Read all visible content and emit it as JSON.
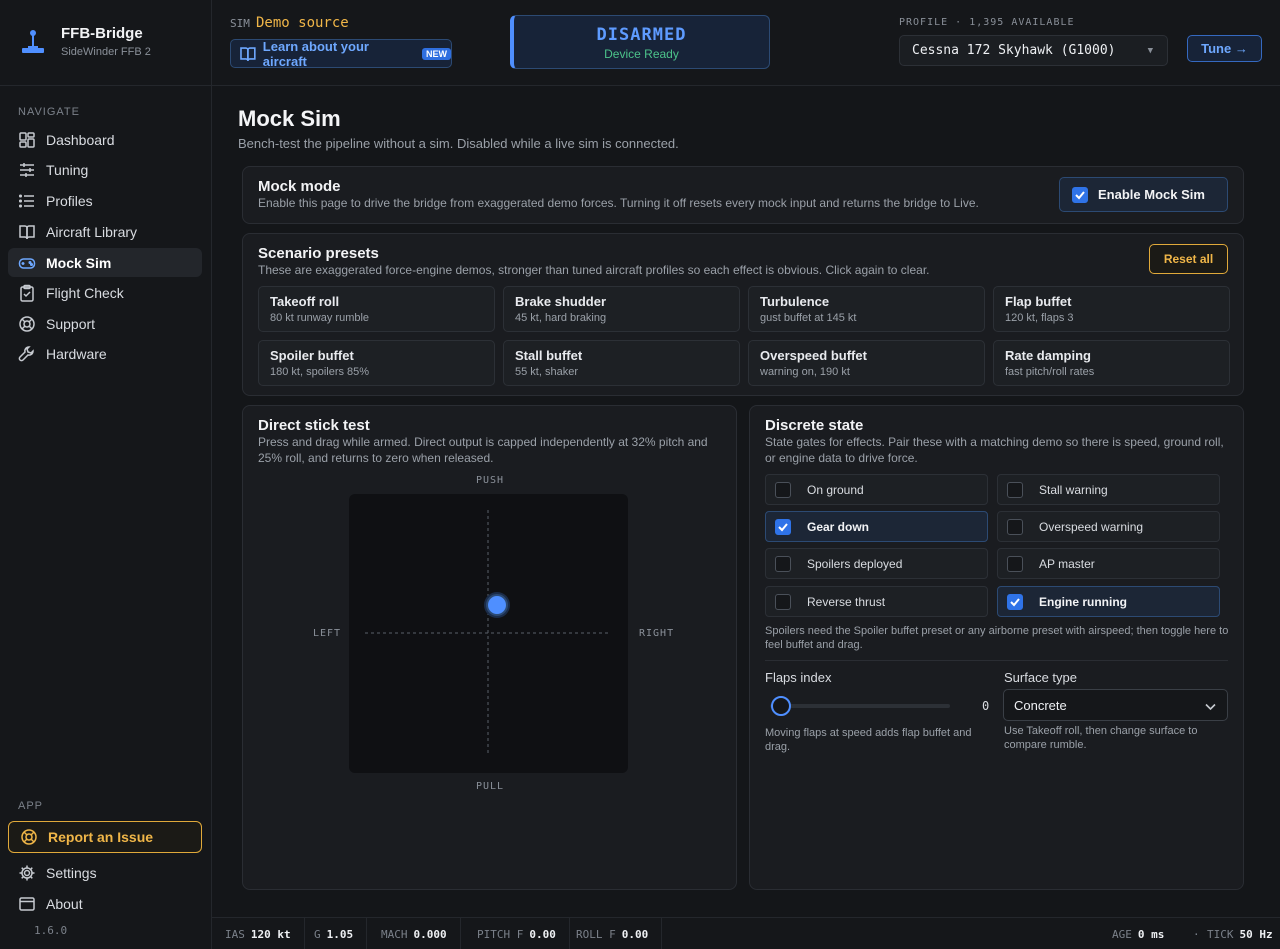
{
  "brand": {
    "title": "FFB-Bridge",
    "subtitle": "SideWinder FFB 2"
  },
  "sidebar": {
    "navigate_heading": "NAVIGATE",
    "items": [
      {
        "label": "Dashboard",
        "icon": "dashboard-icon"
      },
      {
        "label": "Tuning",
        "icon": "sliders-icon"
      },
      {
        "label": "Profiles",
        "icon": "list-icon"
      },
      {
        "label": "Aircraft Library",
        "icon": "book-icon"
      },
      {
        "label": "Mock Sim",
        "icon": "gamepad-icon",
        "active": true
      },
      {
        "label": "Flight Check",
        "icon": "clipboard-check-icon"
      },
      {
        "label": "Support",
        "icon": "lifebuoy-icon"
      },
      {
        "label": "Hardware",
        "icon": "wrench-icon"
      }
    ],
    "app_heading": "APP",
    "report_label": "Report an Issue",
    "settings_label": "Settings",
    "about_label": "About",
    "version": "1.6.0"
  },
  "topbar": {
    "sim_label": "SIM",
    "sim_value": "Demo source",
    "learn_label": "Learn about your aircraft",
    "new_badge": "NEW",
    "arm_status": "DISARMED",
    "arm_sub": "Device Ready",
    "profile_label": "PROFILE · 1,395 AVAILABLE",
    "profile_value": "Cessna 172 Skyhawk (G1000)",
    "tune_label": "Tune →"
  },
  "page": {
    "title": "Mock Sim",
    "subtitle": "Bench-test the pipeline without a sim. Disabled while a live sim is connected."
  },
  "mock_mode": {
    "title": "Mock mode",
    "desc": "Enable this page to drive the bridge from exaggerated demo forces. Turning it off resets every mock input and returns the bridge to Live.",
    "enable_label": "Enable Mock Sim",
    "enabled": true
  },
  "presets": {
    "title": "Scenario presets",
    "desc": "These are exaggerated force-engine demos, stronger than tuned aircraft profiles so each effect is obvious. Click again to clear.",
    "reset_label": "Reset all",
    "items": [
      {
        "name": "Takeoff roll",
        "desc": "80 kt runway rumble"
      },
      {
        "name": "Brake shudder",
        "desc": "45 kt, hard braking"
      },
      {
        "name": "Turbulence",
        "desc": "gust buffet at 145 kt"
      },
      {
        "name": "Flap buffet",
        "desc": "120 kt, flaps 3"
      },
      {
        "name": "Spoiler buffet",
        "desc": "180 kt, spoilers 85%"
      },
      {
        "name": "Stall buffet",
        "desc": "55 kt, shaker"
      },
      {
        "name": "Overspeed buffet",
        "desc": "warning on, 190 kt"
      },
      {
        "name": "Rate damping",
        "desc": "fast pitch/roll rates"
      }
    ]
  },
  "stick": {
    "title": "Direct stick test",
    "desc": "Press and drag while armed. Direct output is capped independently at 32% pitch and 25% roll, and returns to zero when released.",
    "push": "PUSH",
    "pull": "PULL",
    "left": "LEFT",
    "right": "RIGHT",
    "roll": 0.09,
    "pitch": 0.21
  },
  "discrete": {
    "title": "Discrete state",
    "desc": "State gates for effects. Pair these with a matching demo so there is speed, ground roll, or engine data to drive force.",
    "items": [
      {
        "label": "On ground",
        "on": false
      },
      {
        "label": "Stall warning",
        "on": false
      },
      {
        "label": "Gear down",
        "on": true
      },
      {
        "label": "Overspeed warning",
        "on": false
      },
      {
        "label": "Spoilers deployed",
        "on": false
      },
      {
        "label": "AP master",
        "on": false
      },
      {
        "label": "Reverse thrust",
        "on": false
      },
      {
        "label": "Engine running",
        "on": true
      }
    ],
    "note": "Spoilers need the Spoiler buffet preset or any airborne preset with airspeed; then toggle here to feel buffet and drag.",
    "flaps_label": "Flaps index",
    "flaps_value": "0",
    "flaps_note": "Moving flaps at speed adds flap buffet and drag.",
    "surface_label": "Surface type",
    "surface_value": "Concrete",
    "surface_note": "Use Takeoff roll, then change surface to compare rumble."
  },
  "status": {
    "ias_label": "IAS",
    "ias_value": "120 kt",
    "g_label": "G",
    "g_value": "1.05",
    "mach_label": "MACH",
    "mach_value": "0.000",
    "pitchf_label": "PITCH F",
    "pitchf_value": "0.00",
    "rollf_label": "ROLL F",
    "rollf_value": "0.00",
    "age_label": "AGE",
    "age_value": "0 ms",
    "sep": "·",
    "tick_label": "TICK",
    "tick_value": "50 Hz"
  },
  "colors": {
    "accent": "#4f8fff",
    "warn": "#f0b648",
    "ok": "#4cc38a"
  }
}
